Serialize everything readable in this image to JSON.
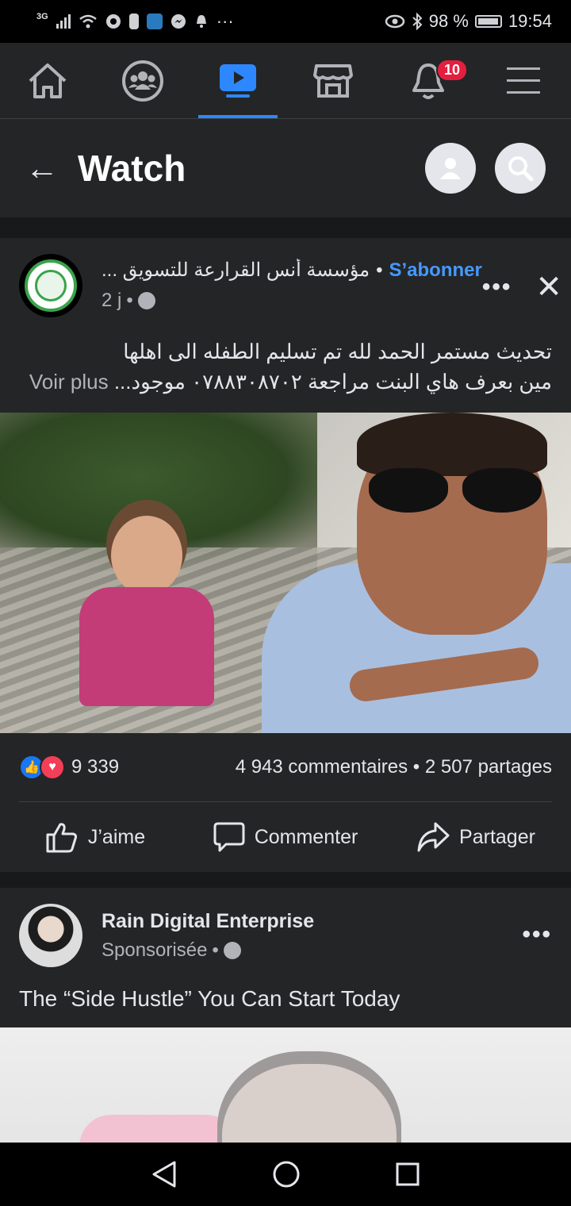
{
  "status_bar": {
    "network": "3G",
    "battery": "98 %",
    "time": "19:54",
    "more": "···"
  },
  "nav": {
    "tabs": [
      {
        "icon": "home-icon"
      },
      {
        "icon": "groups-icon"
      },
      {
        "icon": "watch-icon",
        "active": true
      },
      {
        "icon": "marketplace-icon"
      },
      {
        "icon": "notifications-icon",
        "badge": "10"
      },
      {
        "icon": "menu-icon"
      }
    ],
    "accent": "#2d88ff"
  },
  "header": {
    "title": "Watch"
  },
  "post": {
    "page_name": "مؤسسة أنس القرارعة للتسويق ...",
    "separator": "•",
    "subscribe_label": "S’abonner",
    "time": "2 j",
    "time_sep": "•",
    "text_line1": "تحديث مستمر الحمد لله تم تسليم الطفله الى اهلها",
    "text_line2": "مين بعرف هاي البنت مراجعة ٠٧٨٨٣٠٨٧٠٢ موجود...",
    "see_more": "Voir plus",
    "reaction_count": "9 339",
    "comments_shares": "4 943 commentaires • 2 507 partages",
    "actions": {
      "like": "J’aime",
      "comment": "Commenter",
      "share": "Partager"
    }
  },
  "sponsored": {
    "name": "Rain Digital Enterprise",
    "label": "Sponsorisée",
    "sep": "•",
    "text": "The “Side Hustle” You Can Start Today"
  }
}
